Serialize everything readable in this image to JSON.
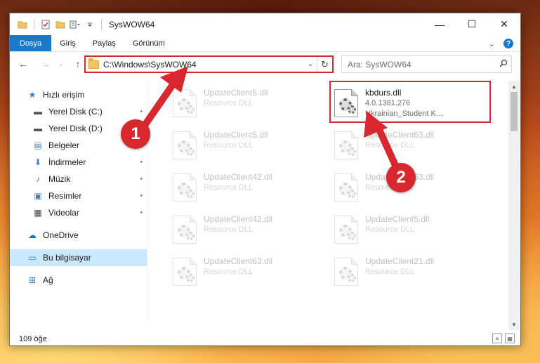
{
  "window": {
    "title": "SysWOW64",
    "minimize_glyph": "—",
    "maximize_glyph": "☐",
    "close_glyph": "✕"
  },
  "ribbon": {
    "tabs": [
      "Dosya",
      "Giriş",
      "Paylaş",
      "Görünüm"
    ],
    "collapse_glyph": "⌄",
    "help_glyph": "?"
  },
  "address": {
    "back_glyph": "←",
    "forward_glyph": "→",
    "up_glyph": "↑",
    "path": "C:\\Windows\\SysWOW64",
    "dropdown_glyph": "⌄",
    "refresh_glyph": "↻"
  },
  "search": {
    "placeholder": "Ara: SysWOW64",
    "icon": "search-icon"
  },
  "sidebar": {
    "items": [
      {
        "label": "Hızlı erişim",
        "icon": "star-icon",
        "glyph": "★",
        "color": "#2f7fd6",
        "pinned": false
      },
      {
        "label": "Yerel Disk (C:)",
        "icon": "drive-icon",
        "glyph": "▬",
        "color": "#505050",
        "pinned": true
      },
      {
        "label": "Yerel Disk (D:)",
        "icon": "drive-icon",
        "glyph": "▬",
        "color": "#505050",
        "pinned": true
      },
      {
        "label": "Belgeler",
        "icon": "documents-icon",
        "glyph": "▤",
        "color": "#4a7fb8",
        "pinned": true
      },
      {
        "label": "İndirmeler",
        "icon": "download-icon",
        "glyph": "⬇",
        "color": "#2f7fd6",
        "pinned": true
      },
      {
        "label": "Müzik",
        "icon": "music-icon",
        "glyph": "♪",
        "color": "#2f7fd6",
        "pinned": true
      },
      {
        "label": "Resimler",
        "icon": "pictures-icon",
        "glyph": "▣",
        "color": "#4a7fb8",
        "pinned": true
      },
      {
        "label": "Videolar",
        "icon": "video-icon",
        "glyph": "▦",
        "color": "#404040",
        "pinned": true
      },
      {
        "label": "OneDrive",
        "icon": "cloud-icon",
        "glyph": "☁",
        "color": "#1e6fc7",
        "pinned": false
      },
      {
        "label": "Bu bilgisayar",
        "icon": "computer-icon",
        "glyph": "▭",
        "color": "#2f7fd6",
        "pinned": false
      },
      {
        "label": "Ağ",
        "icon": "network-icon",
        "glyph": "⊞",
        "color": "#2f7fd6",
        "pinned": false
      }
    ],
    "pin_glyph": "📌"
  },
  "files": [
    {
      "name": "UpdateClient5.dll",
      "sub": "Resource DLL",
      "ghost": true
    },
    {
      "name": "kbdurs.dll",
      "sub": "4.0.1381.276",
      "sub2": "Ukrainian_Student K...",
      "ghost": false
    },
    {
      "name": "UpdateClient5.dll",
      "sub": "Resource DLL",
      "ghost": true
    },
    {
      "name": "UpdateClient63.dll",
      "sub": "Resource DLL",
      "ghost": true
    },
    {
      "name": "UpdateClient42.dll",
      "sub": "Resource DLL",
      "ghost": true
    },
    {
      "name": "UpdateClient63.dll",
      "sub": "Resource DLL",
      "ghost": true
    },
    {
      "name": "UpdateClient42.dll",
      "sub": "Resource DLL",
      "ghost": true
    },
    {
      "name": "UpdateClient5.dll",
      "sub": "Resource DLL",
      "ghost": true
    },
    {
      "name": "UpdateClient63.dll",
      "sub": "Resource DLL",
      "ghost": true
    },
    {
      "name": "UpdateClient21.dll",
      "sub": "Resource DLL",
      "ghost": true
    }
  ],
  "status": {
    "count": "109 öğe"
  },
  "annotations": {
    "callout_1": "1",
    "callout_2": "2",
    "color": "#d9272e"
  }
}
